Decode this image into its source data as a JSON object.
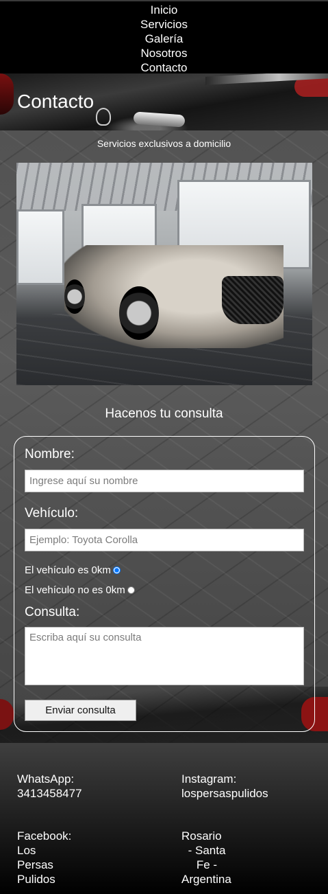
{
  "nav": {
    "items": [
      "Inicio",
      "Servicios",
      "Galería",
      "Nosotros",
      "Contacto"
    ]
  },
  "hero": {
    "title": "Contacto"
  },
  "tagline": "Servicios exclusivos a domicilio",
  "form": {
    "heading": "Hacenos tu consulta",
    "name_label": "Nombre:",
    "name_placeholder": "Ingrese aquí su nombre",
    "vehicle_label": "Vehículo:",
    "vehicle_placeholder": "Ejemplo: Toyota Corolla",
    "radio_0km": "El vehículo es 0km",
    "radio_not_0km": "El vehículo no es 0km",
    "query_label": "Consulta:",
    "query_placeholder": "Escriba aquí su consulta",
    "submit_label": "Enviar consulta"
  },
  "footer": {
    "whatsapp_label": "WhatsApp:",
    "whatsapp_value": "3413458477",
    "instagram_label": "Instagram:",
    "instagram_value": "lospersaspulidos",
    "facebook_label": "Facebook:",
    "facebook_lines": [
      "Los",
      "Persas",
      "Pulidos"
    ],
    "location_lines": [
      "Rosario",
      "- Santa",
      "Fe -",
      "Argentina"
    ]
  }
}
